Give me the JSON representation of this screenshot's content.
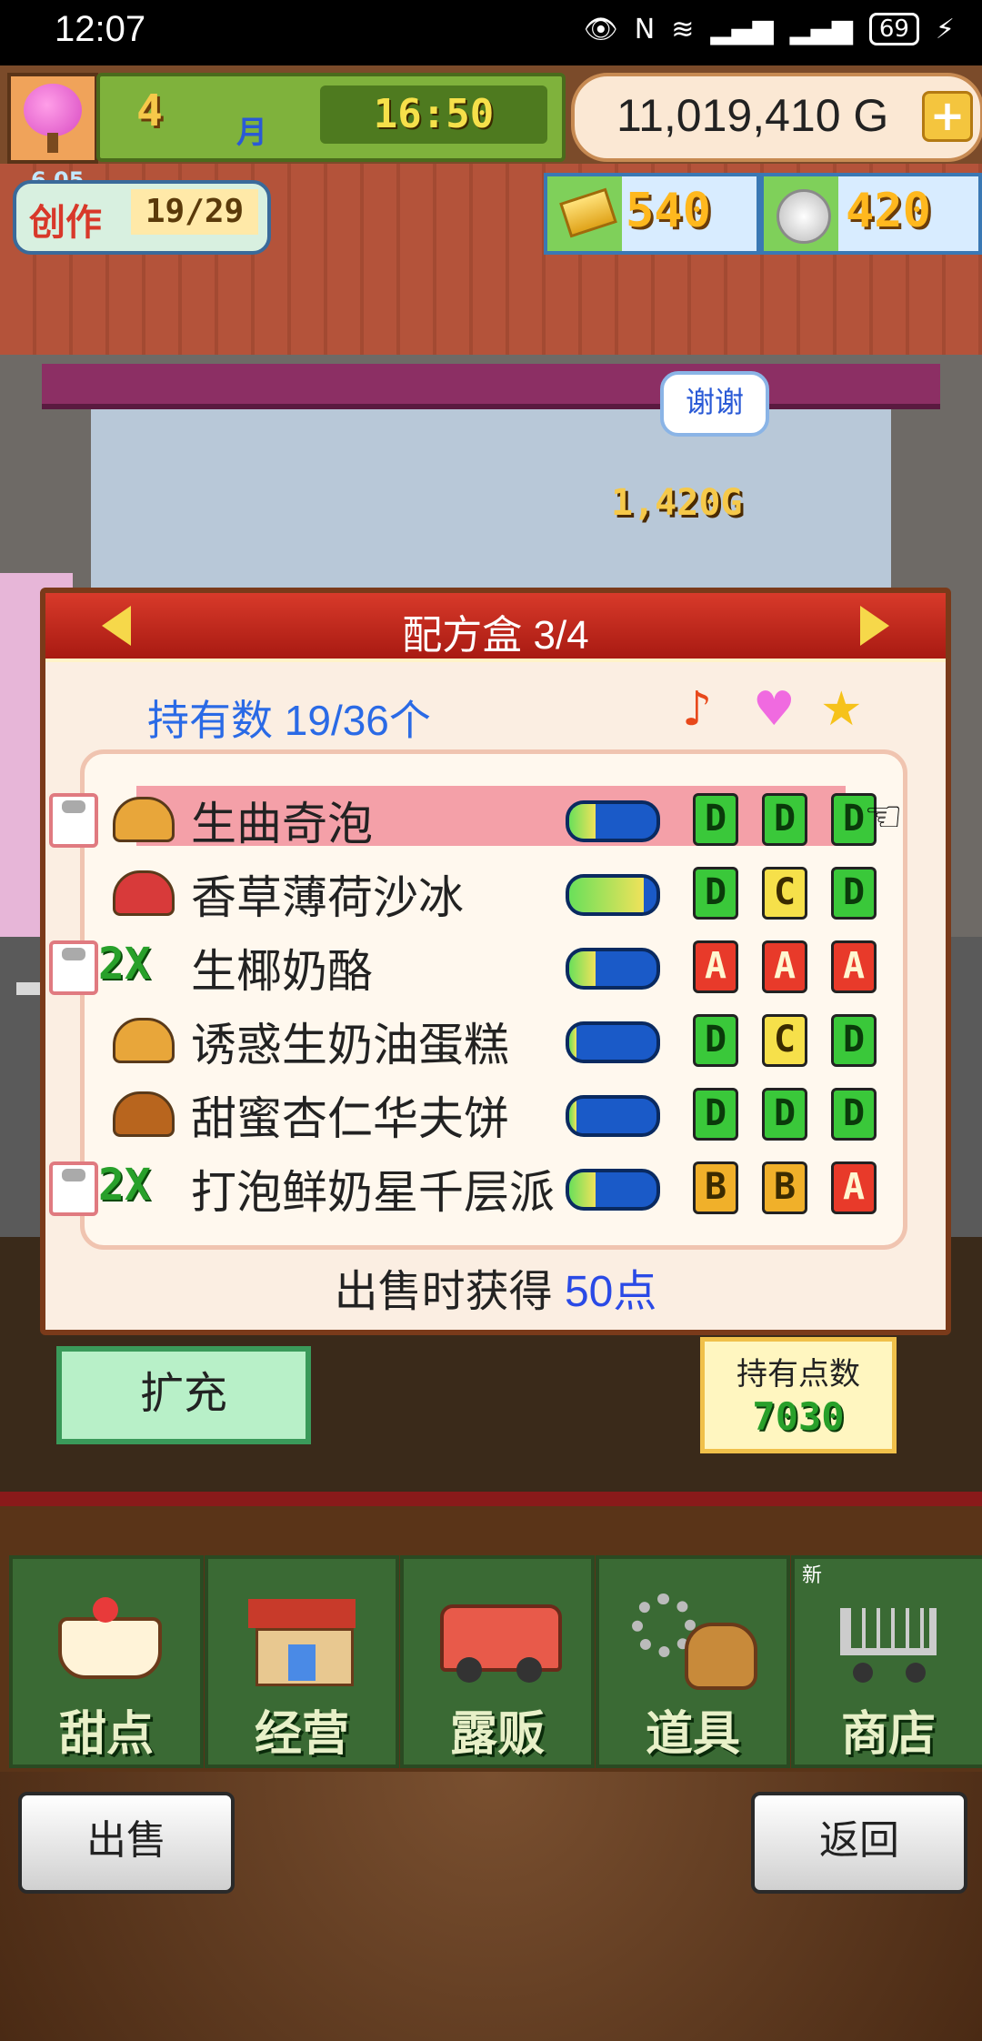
{
  "status_bar": {
    "time": "12:07",
    "battery": "69"
  },
  "hud": {
    "month_num": "4",
    "month_unit": "月",
    "clock": "16:50",
    "gold": "11,019,410 G",
    "plus": "+"
  },
  "resources": {
    "creation_label": "创作",
    "creation_count": "19/29",
    "creation_timer": "6 05",
    "gold_bars": "540",
    "coins": "420"
  },
  "scene": {
    "thanks": "谢谢",
    "sale_amount": "1,420G"
  },
  "panel": {
    "title": "配方盒 3/4",
    "owned": "持有数 19/36个",
    "header_icons": [
      "music-note-icon",
      "heart-icon",
      "star-icon"
    ],
    "earn_prefix": "出售时获得",
    "earn_points": "50点",
    "recipes": [
      {
        "name": "生曲奇泡",
        "chef": true,
        "x2": false,
        "food": "gold",
        "gauge": 0.3,
        "grades": [
          "D",
          "D",
          "D"
        ],
        "selected": true
      },
      {
        "name": "香草薄荷沙冰",
        "chef": false,
        "x2": false,
        "food": "red",
        "gauge": 0.85,
        "grades": [
          "D",
          "C",
          "D"
        ],
        "selected": false
      },
      {
        "name": "生椰奶酪",
        "chef": true,
        "x2": true,
        "food": "",
        "gauge": 0.3,
        "grades": [
          "A",
          "A",
          "A"
        ],
        "selected": false
      },
      {
        "name": "诱惑生奶油蛋糕",
        "chef": false,
        "x2": false,
        "food": "gold",
        "gauge": 0.08,
        "grades": [
          "D",
          "C",
          "D"
        ],
        "selected": false
      },
      {
        "name": "甜蜜杏仁华夫饼",
        "chef": false,
        "x2": false,
        "food": "brown",
        "gauge": 0.08,
        "grades": [
          "D",
          "D",
          "D"
        ],
        "selected": false
      },
      {
        "name": "打泡鲜奶星千层派",
        "chef": true,
        "x2": true,
        "food": "",
        "gauge": 0.3,
        "grades": [
          "B",
          "B",
          "A"
        ],
        "selected": false
      }
    ]
  },
  "actions": {
    "expand": "扩充",
    "points_label": "持有点数",
    "points_value": "7030"
  },
  "nav": [
    {
      "label": "甜点",
      "icon": "cake-icon"
    },
    {
      "label": "经营",
      "icon": "shop-icon"
    },
    {
      "label": "露贩",
      "icon": "food-truck-icon"
    },
    {
      "label": "道具",
      "icon": "gear-bag-icon"
    },
    {
      "label": "商店",
      "icon": "cart-icon",
      "new": "新"
    }
  ],
  "bottom": {
    "sell": "出售",
    "back": "返回"
  }
}
